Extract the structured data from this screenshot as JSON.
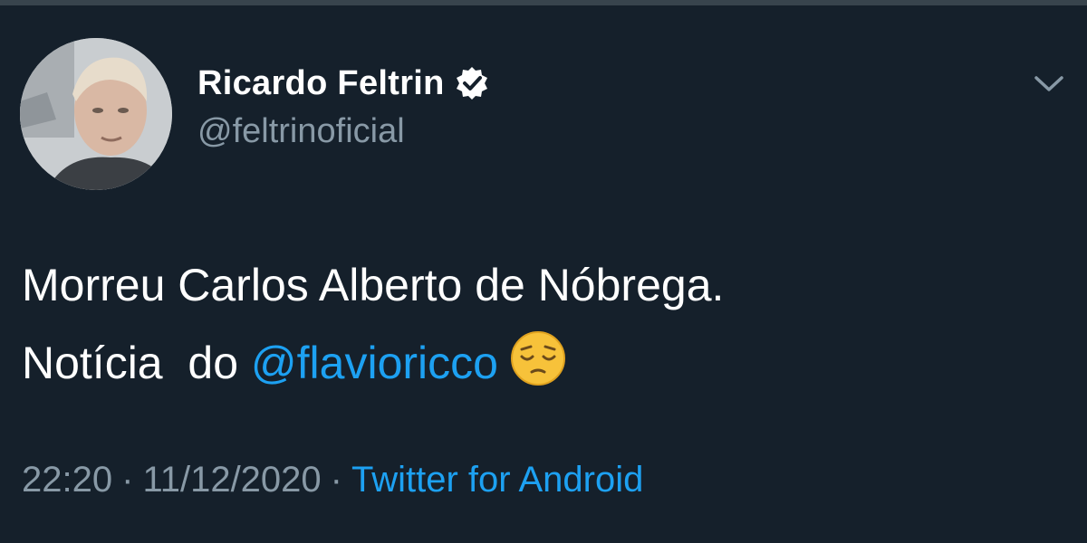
{
  "tweet": {
    "author": {
      "display_name": "Ricardo Feltrin",
      "handle": "@feltrinoficial",
      "verified": true
    },
    "text_line1": "Morreu Carlos Alberto de Nóbrega.",
    "text_line2_prefix": "Notícia  do ",
    "mention": "@flavioricco",
    "emoji": "pensive-face-emoji",
    "time": "22:20",
    "date": "11/12/2020",
    "separator": "·",
    "source": "Twitter for Android"
  },
  "icons": {
    "verified": "verified-badge-icon",
    "menu": "chevron-down-icon"
  },
  "colors": {
    "background": "#15202b",
    "text": "#ffffff",
    "muted": "#8899a6",
    "link": "#1da1f2"
  }
}
